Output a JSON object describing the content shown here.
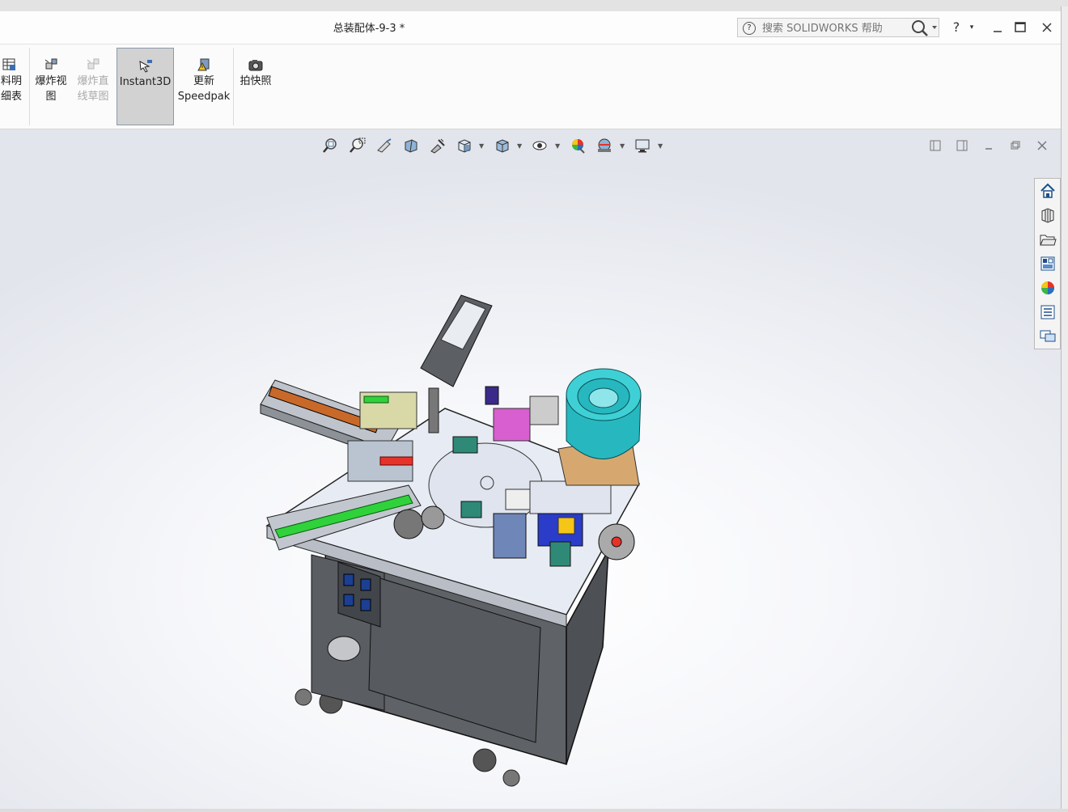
{
  "window": {
    "title": "总装配体-9-3 *",
    "search_placeholder": "搜索 SOLIDWORKS 帮助",
    "help_label": "?"
  },
  "ribbon": {
    "buttons": [
      {
        "line1": "料明",
        "line2": "细表",
        "icon": "bom-icon",
        "state": "normal"
      },
      {
        "line1": "爆炸视",
        "line2": "图",
        "icon": "explode-view-icon",
        "state": "normal"
      },
      {
        "line1": "爆炸直",
        "line2": "线草图",
        "icon": "explode-line-sketch-icon",
        "state": "disabled"
      },
      {
        "line1": "Instant3D",
        "line2": "",
        "icon": "instant3d-icon",
        "state": "active"
      },
      {
        "line1": "更新",
        "line2": "Speedpak",
        "icon": "speedpak-icon",
        "state": "normal"
      },
      {
        "line1": "拍快照",
        "line2": "",
        "icon": "camera-icon",
        "state": "normal"
      }
    ]
  },
  "heads_up_toolbar": [
    "zoom-to-fit-icon",
    "zoom-to-area-icon",
    "previous-view-icon",
    "section-view-icon",
    "dynamic-annotation-icon",
    "view-orientation-icon",
    "display-style-icon",
    "hide-show-items-icon",
    "edit-appearance-icon",
    "apply-scene-icon",
    "view-settings-icon"
  ],
  "task_pane": [
    "home-icon",
    "design-library-icon",
    "file-explorer-icon",
    "view-palette-icon",
    "appearances-icon",
    "custom-properties-icon",
    "forum-icon"
  ],
  "colors": {
    "accent_teal": "#27b8bf",
    "machine_gray": "#5f6266",
    "table_top": "#e7ebf3",
    "conveyor_green": "#2fd23a"
  }
}
